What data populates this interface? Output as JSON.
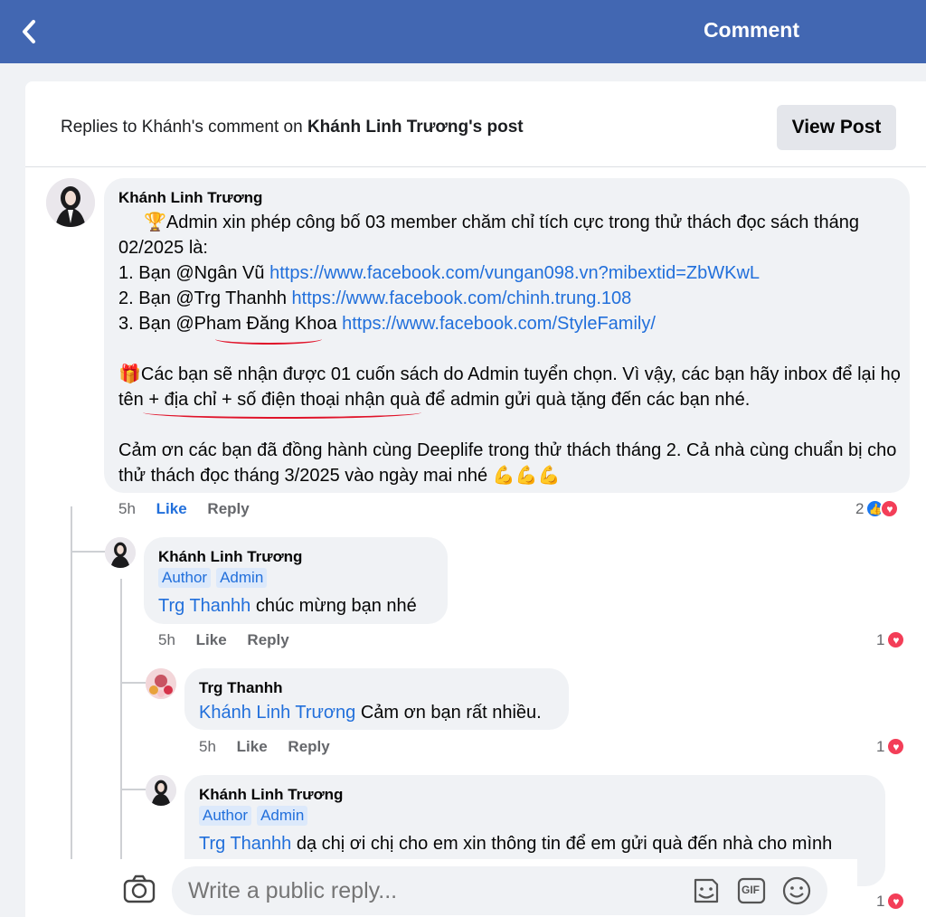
{
  "topbar": {
    "back_icon": "chevron-left-icon",
    "title": "Comment"
  },
  "header": {
    "replies_prefix": "Replies to Khánh's comment on ",
    "post_owner": "Khánh Linh Trương",
    "replies_suffix": "'s post",
    "view_post": "View Post"
  },
  "main_comment": {
    "author": "Khánh Linh Trương",
    "line1": "🏆Admin xin phép công bố 03 member chăm chỉ tích cực trong thử thách đọc sách tháng 02/2025 là:",
    "item1_prefix": "1. Bạn @Ngân Vũ ",
    "item1_link": "https://www.facebook.com/vungan098.vn?mibextid=ZbWKwL",
    "item2_prefix": "2. Bạn @Trg Thanhh ",
    "item2_link": "https://www.facebook.com/chinh.trung.108",
    "item3_prefix": "3. Bạn @Pham Đăng Khoa ",
    "item3_link": "https://www.facebook.com/StyleFamily/",
    "para2": "🎁Các bạn sẽ nhận được 01 cuốn sách do Admin tuyển chọn. Vì vậy, các bạn hãy inbox để lại họ tên + địa chỉ + số điện thoại nhận quà để admin gửi quà tặng đến các bạn nhé.",
    "para3": "Cảm ơn các bạn đã đồng hành cùng Deeplife trong thử thách tháng 2. Cả nhà cùng chuẩn bị cho thử thách đọc tháng 3/2025 vào ngày mai nhé 💪💪💪",
    "time": "5h",
    "like": "Like",
    "reply": "Reply",
    "reaction_count": "2"
  },
  "reply1": {
    "author": "Khánh Linh Trương",
    "badges": [
      "Author",
      "Admin"
    ],
    "mention": "Trg Thanhh",
    "text": " chúc mừng bạn nhé",
    "time": "5h",
    "like": "Like",
    "reply": "Reply",
    "reaction_count": "1"
  },
  "reply2": {
    "author": "Trg Thanhh",
    "mention": "Khánh Linh Trương",
    "text": " Cảm ơn bạn rất nhiều.",
    "time": "5h",
    "like": "Like",
    "reply": "Reply",
    "reaction_count": "1"
  },
  "reply3": {
    "author": "Khánh Linh Trương",
    "badges": [
      "Author",
      "Admin"
    ],
    "mention": "Trg Thanhh",
    "text": " dạ chị ơi chị cho em xin thông tin để em gửi quà đến nhà cho mình",
    "reaction_count": "1"
  },
  "reply_bar": {
    "placeholder": "Write a public reply...",
    "icons": [
      "camera-icon",
      "sticker-icon",
      "gif-icon",
      "emoji-icon"
    ],
    "gif_label": "GIF"
  },
  "colors": {
    "topbar": "#4267b2",
    "link": "#216fdb",
    "underline": "#e0142a"
  }
}
